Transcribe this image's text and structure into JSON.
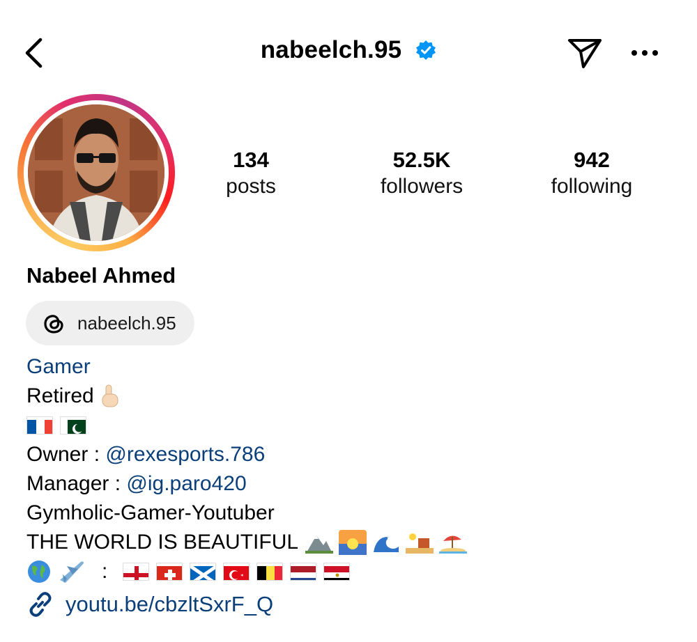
{
  "header": {
    "username": "nabeelch.95",
    "icons": {
      "back": "chevron-left-icon",
      "verified": "verified-badge-icon",
      "send": "paper-plane-icon",
      "more": "ellipsis-icon"
    },
    "accent_verified": "#0095f6"
  },
  "profile": {
    "display_name": "Nabeel Ahmed",
    "threads_handle": "nabeelch.95",
    "stats": [
      {
        "value": "134",
        "label": "posts"
      },
      {
        "value": "52.5K",
        "label": "followers"
      },
      {
        "value": "942",
        "label": "following"
      }
    ]
  },
  "bio": {
    "category": "Gamer",
    "line_retired": "Retired",
    "owner_prefix": "Owner : ",
    "owner_handle": "@rexesports.786",
    "manager_prefix": "Manager : ",
    "manager_handle": "@ig.paro420",
    "tagline": "Gymholic-Gamer-Youtuber",
    "world_text": "THE WORLD IS BEAUTIFUL",
    "travel_separator": ":",
    "flags_row1": [
      "France",
      "Pakistan"
    ],
    "flags_row2": [
      "England",
      "Switzerland",
      "Scotland",
      "Turkey",
      "Belgium",
      "Netherlands",
      "Egypt"
    ]
  },
  "link": {
    "url_text": "youtu.be/cbzltSxrF_Q",
    "icon": "link-icon"
  },
  "colors": {
    "link": "#0b3f7a",
    "chip_bg": "#efefef"
  }
}
